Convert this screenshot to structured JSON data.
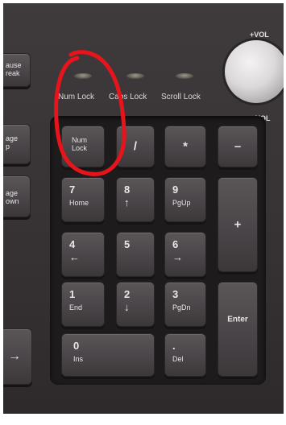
{
  "indicators": {
    "num_lock": "Num Lock",
    "caps_lock": "Caps Lock",
    "scroll_lock": "Scroll Lock"
  },
  "volume": {
    "up": "+VOL",
    "down": "-VOL"
  },
  "left_cut_keys": {
    "pause": "ause\nreak",
    "page_up": "age\np",
    "page_down": "age\nown"
  },
  "keys": {
    "numlock": "Num\nLock",
    "divide": "/",
    "multiply": "*",
    "minus": "–",
    "seven": "7",
    "seven_sub": "Home",
    "eight": "8",
    "eight_sub": "↑",
    "nine": "9",
    "nine_sub": "PgUp",
    "plus": "+",
    "four": "4",
    "four_sub": "←",
    "five": "5",
    "six": "6",
    "six_sub": "→",
    "one": "1",
    "one_sub": "End",
    "two": "2",
    "two_sub": "↓",
    "three": "3",
    "three_sub": "PgDn",
    "enter": "Enter",
    "zero": "0",
    "zero_sub": "Ins",
    "dot": ".",
    "dot_sub": "Del",
    "arrow_right": "→"
  },
  "annotation": {
    "color": "#e8141c"
  }
}
